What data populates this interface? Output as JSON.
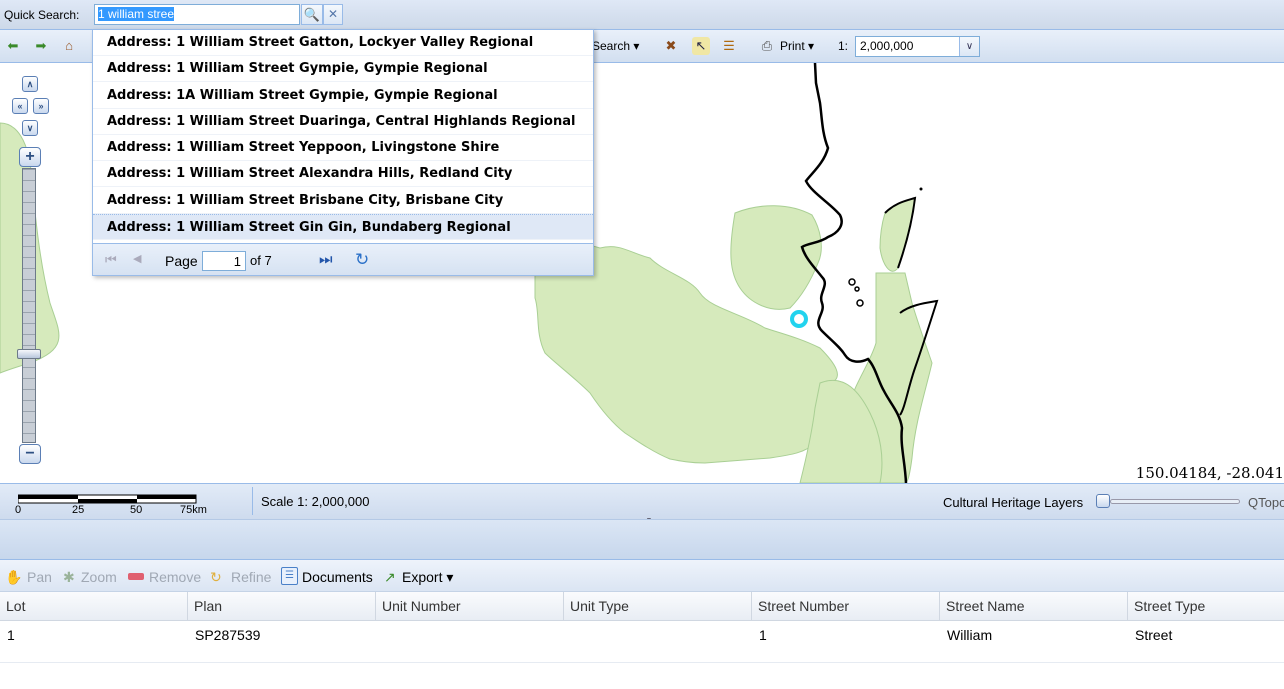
{
  "quick_search": {
    "label": "Quick Search:",
    "value": "1 william stree",
    "search_icon": "magnifier-icon",
    "clear_icon": "close-icon"
  },
  "toolbar": {
    "search_label": "Search ▾",
    "print_label": "Print ▾",
    "scale_prefix": "1:",
    "scale_value": "2,000,000"
  },
  "results": [
    "Address: 1 William Street Gatton, Lockyer Valley Regional",
    "Address: 1 William Street Gympie, Gympie Regional",
    "Address: 1A William Street Gympie, Gympie Regional",
    "Address: 1 William Street Duaringa, Central Highlands Regional",
    "Address: 1 William Street Yeppoon, Livingstone Shire",
    "Address: 1 William Street Alexandra Hills, Redland City",
    "Address: 1 William Street Brisbane City, Brisbane City",
    "Address: 1 William Street Gin Gin, Bundaberg Regional"
  ],
  "pager": {
    "page_label": "Page",
    "page_value": "1",
    "of_label": "of 7"
  },
  "map": {
    "coordinates": "150.04184, -28.041",
    "land_color": "#d6eabc",
    "marker_color": "#22d3ee"
  },
  "scalebar": {
    "ticks": [
      "0",
      "25",
      "50",
      "75km"
    ],
    "scale_text": "Scale 1: 2,000,000",
    "layers_label": "Cultural Heritage Layers",
    "slider_end_label": "QTopo"
  },
  "results_toolbar": {
    "pan": "Pan",
    "zoom": "Zoom",
    "remove": "Remove",
    "refine": "Refine",
    "documents": "Documents",
    "export": "Export ▾"
  },
  "grid": {
    "columns": [
      "Lot",
      "Plan",
      "Unit Number",
      "Unit Type",
      "Street Number",
      "Street Name",
      "Street Type"
    ],
    "rows": [
      [
        "1",
        "SP287539",
        "",
        "",
        "1",
        "William",
        "Street"
      ]
    ]
  }
}
